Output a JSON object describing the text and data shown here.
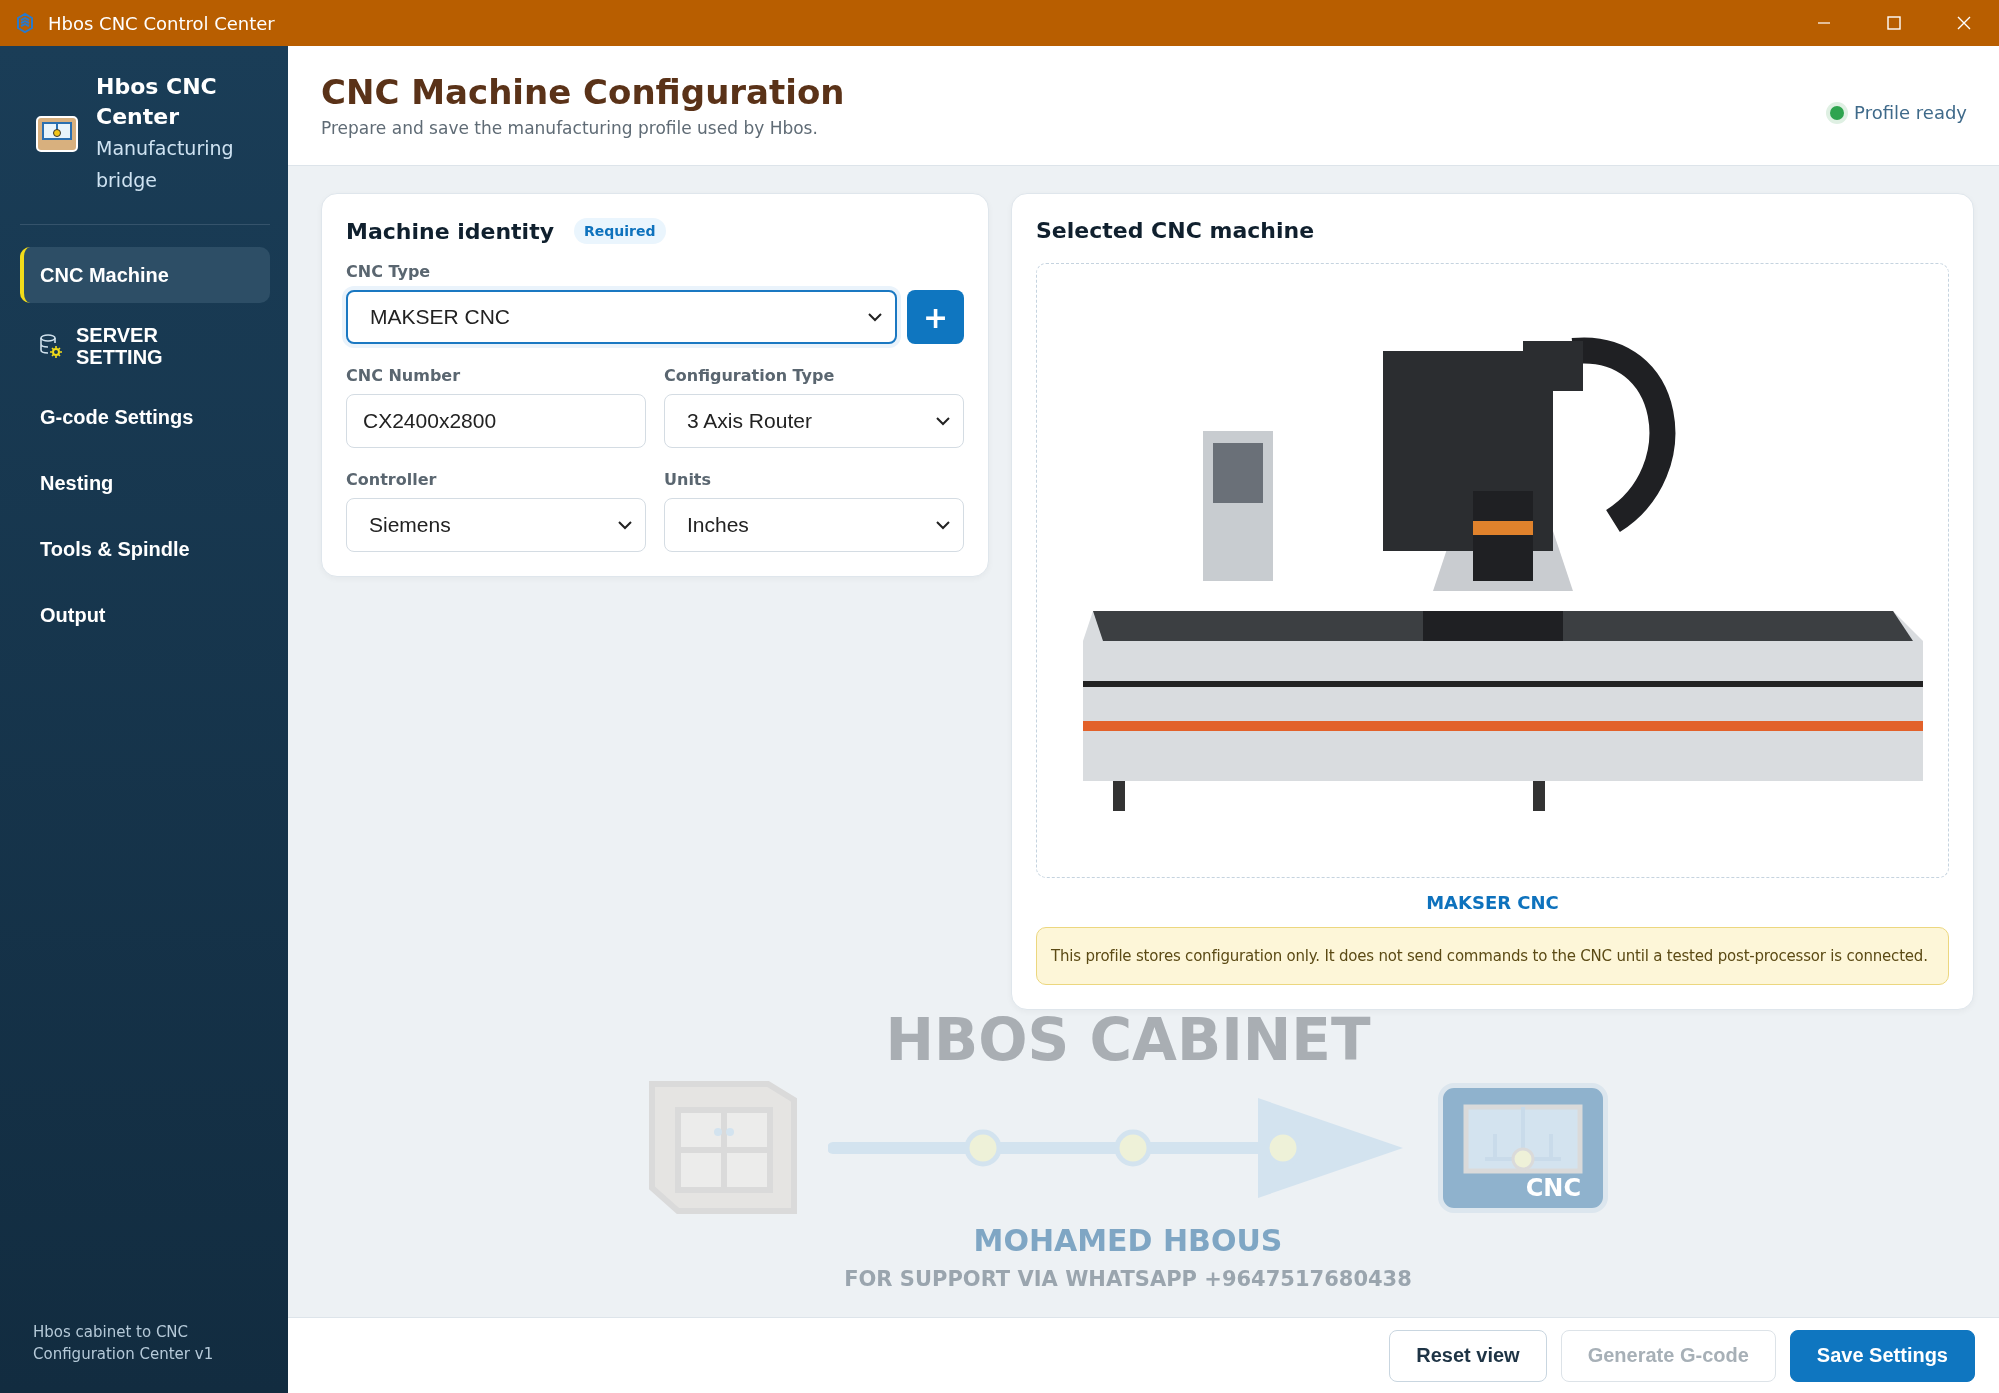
{
  "window": {
    "title": "Hbos CNC Control Center"
  },
  "sidebar": {
    "brand": {
      "title": "Hbos CNC Center",
      "subtitle": "Manufacturing bridge"
    },
    "items": [
      {
        "label": "CNC Machine",
        "kind": "plain",
        "selected": true
      },
      {
        "label": "SERVER SETTING",
        "kind": "server",
        "selected": false
      },
      {
        "label": "G-code Settings",
        "kind": "plain",
        "selected": false
      },
      {
        "label": "Nesting",
        "kind": "plain",
        "selected": false
      },
      {
        "label": "Tools & Spindle",
        "kind": "plain",
        "selected": false
      },
      {
        "label": "Output",
        "kind": "plain",
        "selected": false
      }
    ],
    "footer": "Hbos cabinet to CNC Configuration Center v1"
  },
  "header": {
    "title": "CNC Machine Configuration",
    "subtitle": "Prepare and save the manufacturing profile used by Hbos.",
    "status": {
      "label": "Profile ready",
      "color": "#2ea44f"
    }
  },
  "identity": {
    "title": "Machine identity",
    "badge": "Required",
    "cnc_type": {
      "label": "CNC Type",
      "value": "MAKSER CNC",
      "focused": true,
      "add_button": "+"
    },
    "fields": [
      {
        "label": "CNC Number",
        "kind": "text",
        "value": "CX2400x2800"
      },
      {
        "label": "Configuration Type",
        "kind": "select",
        "value": "3 Axis Router"
      },
      {
        "label": "Controller",
        "kind": "select",
        "value": "Siemens"
      },
      {
        "label": "Units",
        "kind": "select",
        "value": "Inches"
      }
    ]
  },
  "preview": {
    "title": "Selected CNC machine",
    "caption": "MAKSER CNC",
    "notice": "This profile stores configuration only. It does not send commands to the CNC until a tested post-processor is connected."
  },
  "backdrop": {
    "headline": "HBOS CABINET",
    "badge": "CNC",
    "author": "MOHAMED HBOUS",
    "support": "FOR SUPPORT VIA WHATSAPP +9647517680438"
  },
  "actions": [
    {
      "label": "Reset view",
      "kind": "secondary",
      "disabled": false
    },
    {
      "label": "Generate G-code",
      "kind": "secondary",
      "disabled": true
    },
    {
      "label": "Save Settings",
      "kind": "primary",
      "disabled": false
    }
  ]
}
